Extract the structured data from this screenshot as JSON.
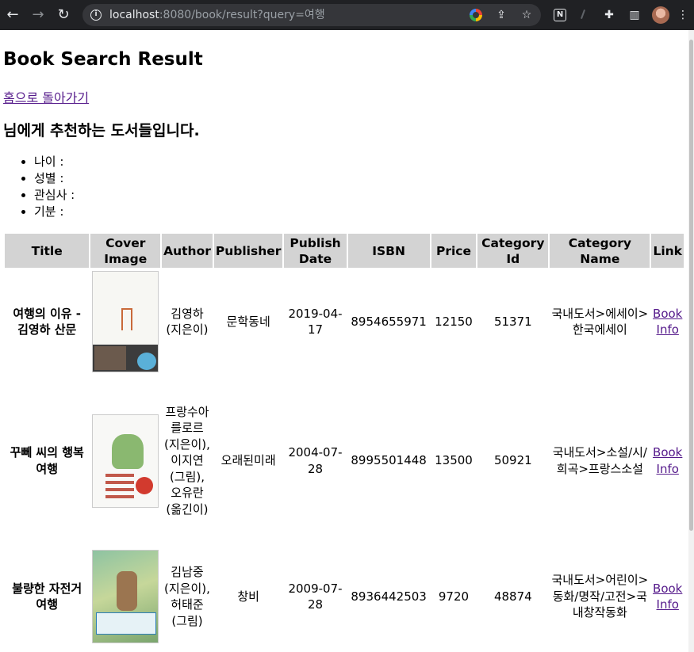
{
  "browser": {
    "url_host": "localhost",
    "url_rest": ":8080/book/result?query=여행",
    "icons": {
      "back": "arrow-left-icon",
      "forward": "arrow-right-icon",
      "reload": "reload-icon",
      "info": "info-icon",
      "google": "google-icon",
      "share": "share-icon",
      "bookmark": "star-icon",
      "notion": "notion-icon",
      "extensions": "puzzle-icon",
      "sidepanel": "side-panel-icon",
      "profile": "avatar",
      "menu": "kebab-menu-icon"
    }
  },
  "page": {
    "title": "Book Search Result",
    "home_link": "홈으로 돌아가기",
    "recommend_heading": "님에게 추천하는 도서들입니다.",
    "profile": [
      {
        "label": "나이 :"
      },
      {
        "label": "성별 :"
      },
      {
        "label": "관심사 :"
      },
      {
        "label": "기분 :"
      }
    ]
  },
  "table": {
    "headers": [
      "Title",
      "Cover Image",
      "Author",
      "Publisher",
      "Publish Date",
      "ISBN",
      "Price",
      "Category Id",
      "Category Name",
      "Link"
    ],
    "rows": [
      {
        "title": "여행의 이유 - 김영하 산문",
        "author": "김영하 (지은이)",
        "publisher": "문학동네",
        "publish_date": "2019-04-17",
        "isbn": "8954655971",
        "price": "12150",
        "category_id": "51371",
        "category_name": "국내도서>에세이>한국에세이",
        "link": "Book Info"
      },
      {
        "title": "꾸뻬 씨의 행복 여행",
        "author": "프랑수아 를로르 (지은이), 이지연 (그림), 오유란 (옮긴이)",
        "publisher": "오래된미래",
        "publish_date": "2004-07-28",
        "isbn": "8995501448",
        "price": "13500",
        "category_id": "50921",
        "category_name": "국내도서>소설/시/희곡>프랑스소설",
        "link": "Book Info"
      },
      {
        "title": "불량한 자전거 여행",
        "author": "김남중 (지은이), 허태준 (그림)",
        "publisher": "창비",
        "publish_date": "2009-07-28",
        "isbn": "8936442503",
        "price": "9720",
        "category_id": "48874",
        "category_name": "국내도서>어린이>동화/명작/고전>국내창작동화",
        "link": "Book Info"
      }
    ]
  }
}
